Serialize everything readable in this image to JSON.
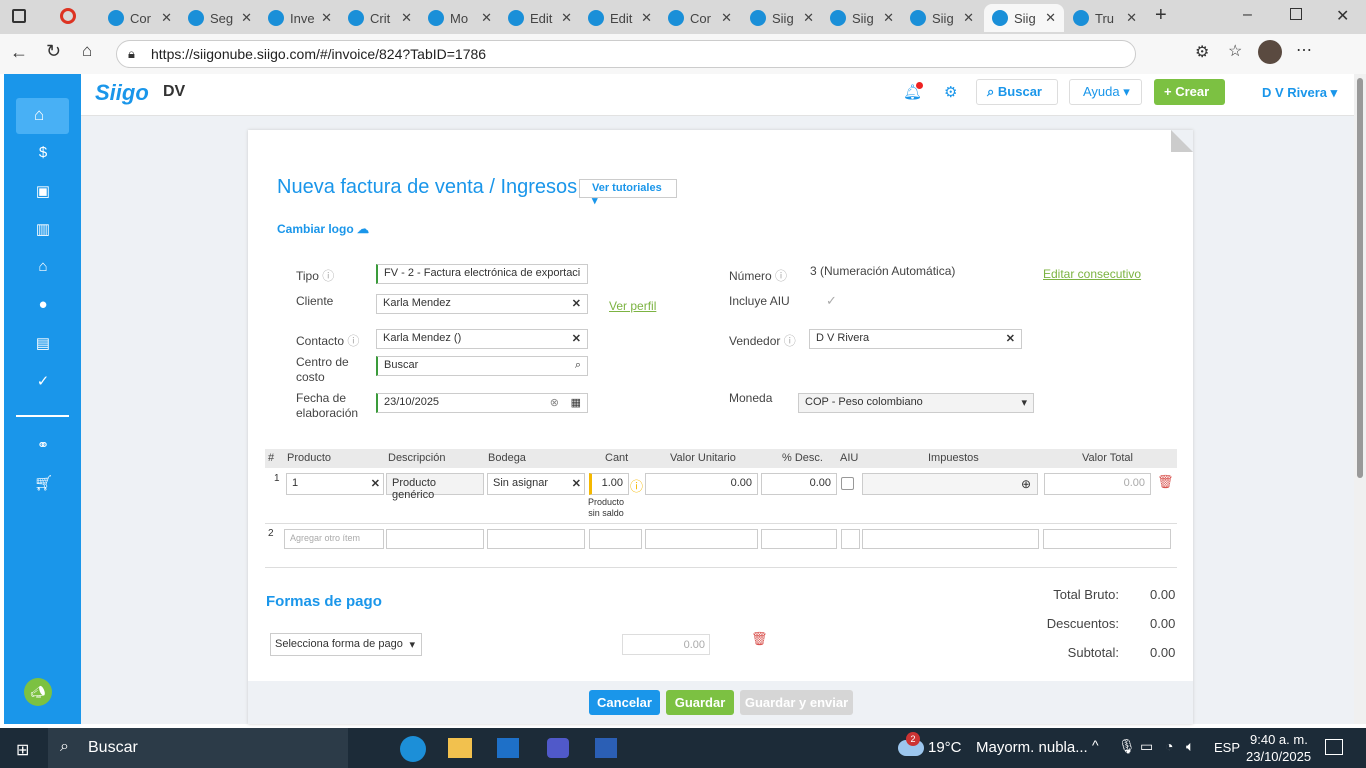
{
  "browser": {
    "tabs": [
      "Cor",
      "Seg",
      "Inve",
      "Crit",
      "Mo",
      "Edit",
      "Edit",
      "Cor",
      "Siig",
      "Siig",
      "Siig",
      "Siig",
      "Tru"
    ],
    "active_tab": 11,
    "url": "https://siigonube.siigo.com/#/invoice/824?TabID=1786"
  },
  "header": {
    "logo": "Siigo",
    "company": "DV",
    "search": "Buscar",
    "help": "Ayuda",
    "create": "Crear",
    "user": "D V Rivera"
  },
  "form": {
    "title": "Nueva factura de venta / Ingresos",
    "tutorials": "Ver tutoriales",
    "change_logo": "Cambiar logo",
    "tipo_label": "Tipo",
    "tipo": "FV - 2 - Factura electrónica de exportaci",
    "cliente_label": "Cliente",
    "cliente": "Karla Mendez",
    "ver_perfil": "Ver perfil",
    "contacto_label": "Contacto",
    "contacto": "Karla Mendez ()",
    "centro_label": "Centro de costo",
    "centro_placeholder": "Buscar",
    "fecha_label": "Fecha de elaboración",
    "fecha": "23/10/2025",
    "numero_label": "Número",
    "numero": "3 (Numeración Automática)",
    "editar": "Editar consecutivo",
    "aiu_label": "Incluye AIU",
    "vendedor_label": "Vendedor",
    "vendedor": "D V Rivera",
    "moneda_label": "Moneda",
    "moneda": "COP - Peso colombiano"
  },
  "table": {
    "headers": [
      "#",
      "Producto",
      "Descripción",
      "Bodega",
      "Cant",
      "Valor Unitario",
      "% Desc.",
      "AIU",
      "Impuestos",
      "Valor Total"
    ],
    "row1": {
      "num": "1",
      "producto": "1",
      "descripcion": "Producto genérico",
      "bodega": "Sin asignar",
      "cant": "1.00",
      "warning": "Producto sin saldo",
      "valor": "0.00",
      "desc": "0.00",
      "total": "0.00"
    },
    "row2": {
      "num": "2",
      "placeholder": "Agregar otro ítem"
    }
  },
  "payment": {
    "title": "Formas de pago",
    "select": "Selecciona forma de pago",
    "value": "0.00"
  },
  "totals": [
    {
      "label": "Total Bruto:",
      "value": "0.00"
    },
    {
      "label": "Descuentos:",
      "value": "0.00"
    },
    {
      "label": "Subtotal:",
      "value": "0.00"
    }
  ],
  "actions": {
    "cancel": "Cancelar",
    "save": "Guardar",
    "save_send": "Guardar y enviar"
  },
  "taskbar": {
    "search": "Buscar",
    "weather": "19°C",
    "weather_text": "Mayorm. nubla...",
    "badge": "2",
    "lang": "ESP",
    "time": "9:40 a. m.",
    "date": "23/10/2025"
  }
}
